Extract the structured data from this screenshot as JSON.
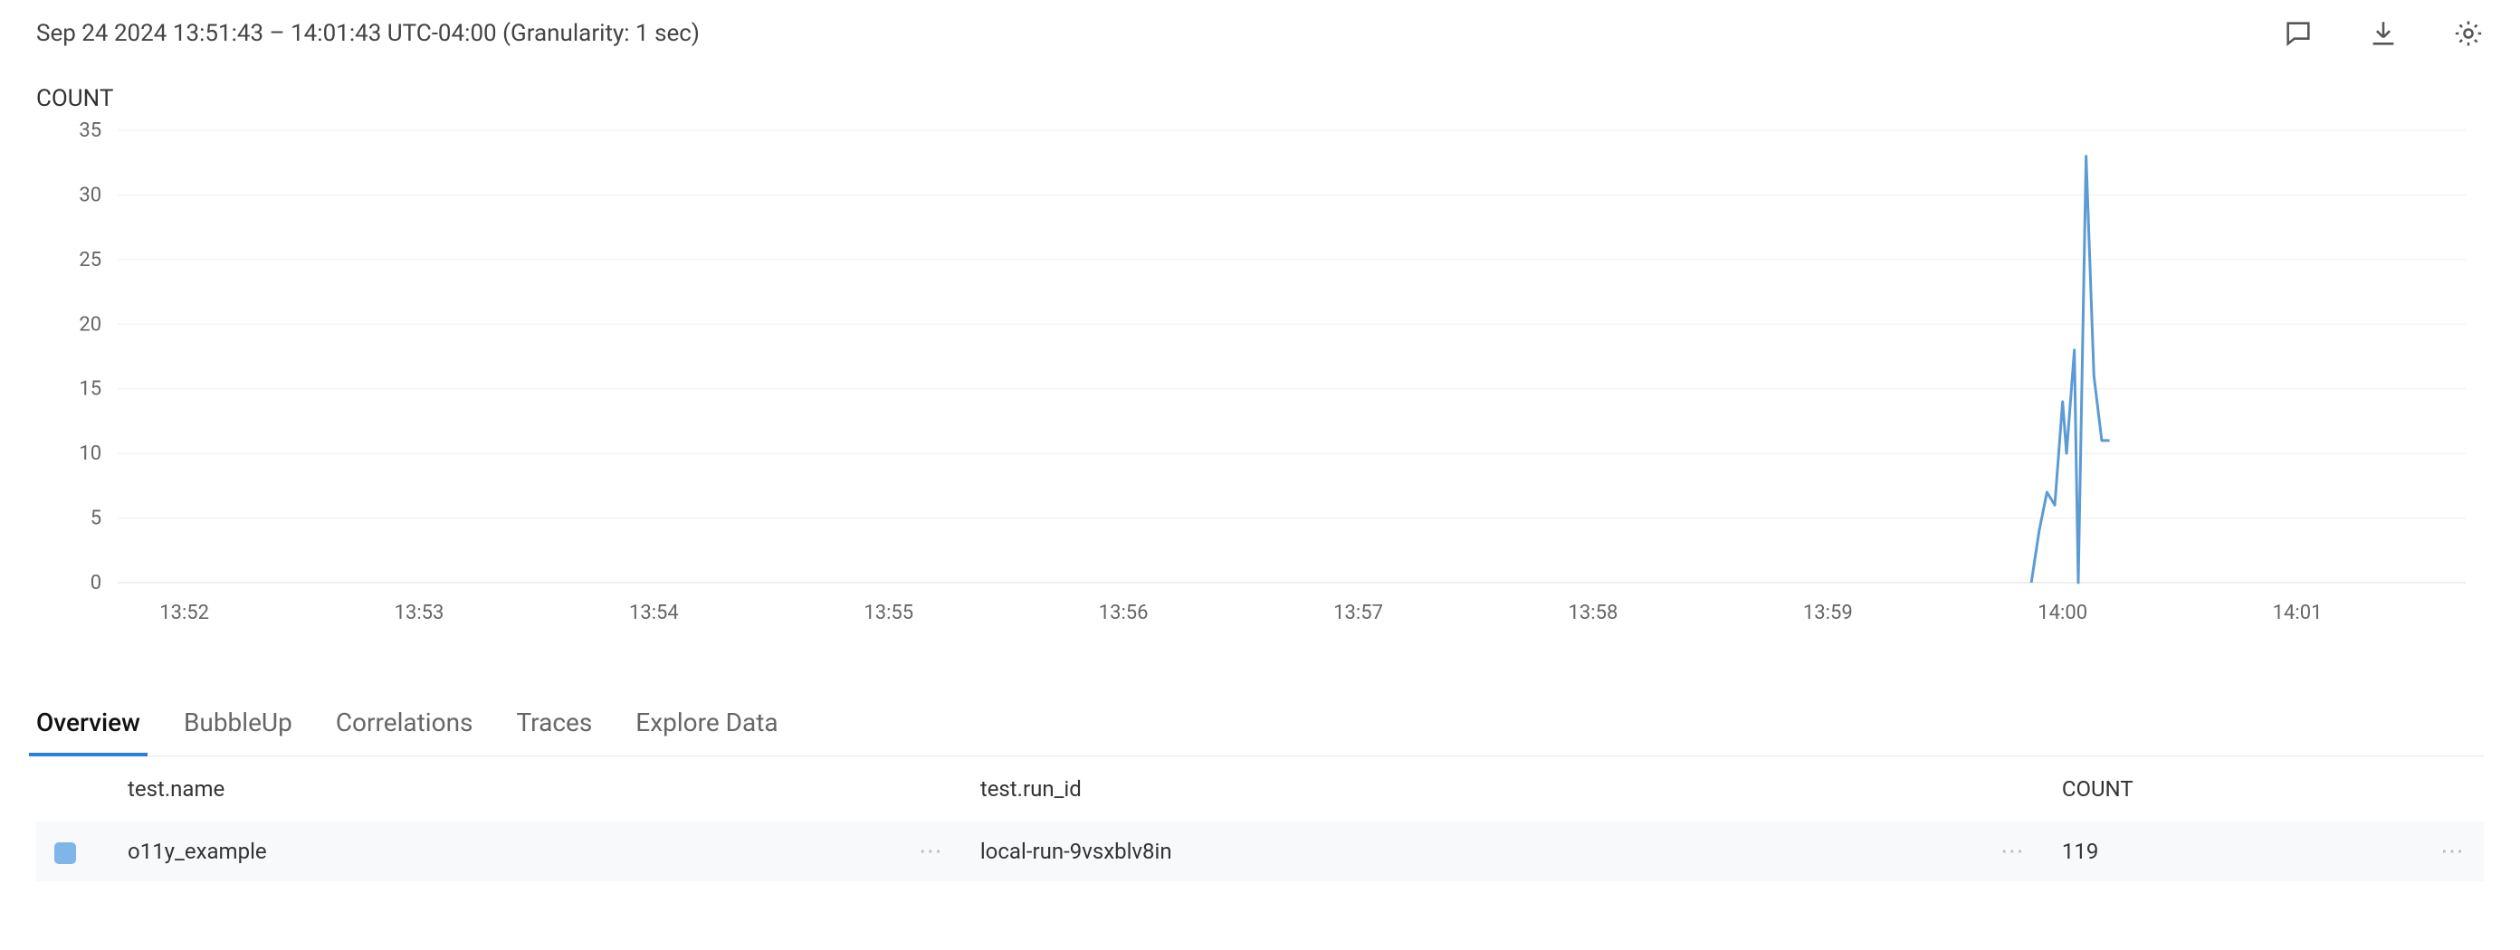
{
  "header": {
    "time_range": "Sep 24 2024 13:51:43 – 14:01:43 UTC-04:00 (Granularity: 1 sec)"
  },
  "chart_title": "COUNT",
  "chart_data": {
    "type": "line",
    "xlabel": "",
    "ylabel": "",
    "ylim": [
      0,
      35
    ],
    "y_ticks": [
      0,
      5,
      10,
      15,
      20,
      25,
      30,
      35
    ],
    "x_tick_labels": [
      "13:52",
      "13:53",
      "13:54",
      "13:55",
      "13:56",
      "13:57",
      "13:58",
      "13:59",
      "14:00",
      "14:01"
    ],
    "x_range_sec": [
      0,
      600
    ],
    "series": [
      {
        "name": "o11y_example / local-run-9vsxblv8in",
        "color": "#5b9bd5",
        "points": [
          {
            "t": 489,
            "v": 0
          },
          {
            "t": 491,
            "v": 4
          },
          {
            "t": 493,
            "v": 7
          },
          {
            "t": 495,
            "v": 6
          },
          {
            "t": 497,
            "v": 14
          },
          {
            "t": 498,
            "v": 10
          },
          {
            "t": 500,
            "v": 18
          },
          {
            "t": 501,
            "v": 0
          },
          {
            "t": 503,
            "v": 33
          },
          {
            "t": 505,
            "v": 16
          },
          {
            "t": 507,
            "v": 11
          },
          {
            "t": 509,
            "v": 11
          }
        ]
      }
    ]
  },
  "tabs": {
    "items": [
      "Overview",
      "BubbleUp",
      "Correlations",
      "Traces",
      "Explore Data"
    ],
    "active": 0
  },
  "table": {
    "columns": [
      "test.name",
      "test.run_id",
      "COUNT"
    ],
    "rows": [
      {
        "swatch": "#7fb5e8",
        "test_name": "o11y_example",
        "run_id": "local-run-9vsxblv8in",
        "count": "119"
      }
    ]
  }
}
